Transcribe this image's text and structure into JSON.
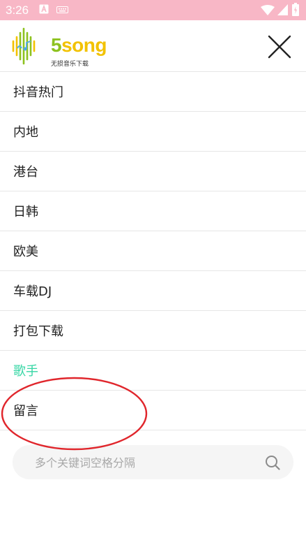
{
  "status_bar": {
    "time": "3:26",
    "icons": [
      "a-notification-icon",
      "keyboard-icon",
      "wifi-icon",
      "signal-icon",
      "battery-icon"
    ]
  },
  "header": {
    "logo_text_five": "5",
    "logo_text_song": "song",
    "logo_tagline": "无损音乐下载",
    "close_icon": "close-icon"
  },
  "menu": {
    "items": [
      {
        "label": "抖音热门",
        "active": false
      },
      {
        "label": "内地",
        "active": false
      },
      {
        "label": "港台",
        "active": false
      },
      {
        "label": "日韩",
        "active": false
      },
      {
        "label": "欧美",
        "active": false
      },
      {
        "label": "车载DJ",
        "active": false
      },
      {
        "label": "打包下载",
        "active": false
      },
      {
        "label": "歌手",
        "active": true
      },
      {
        "label": "留言",
        "active": false
      }
    ]
  },
  "search": {
    "placeholder": "多个关键词空格分隔",
    "value": "",
    "icon": "search-icon"
  },
  "colors": {
    "status_bar": "#f8b7c6",
    "active_item": "#35d6a4",
    "logo_yellow": "#f2c200",
    "logo_green": "#8dc21f",
    "annotation_red": "#e0262c"
  }
}
